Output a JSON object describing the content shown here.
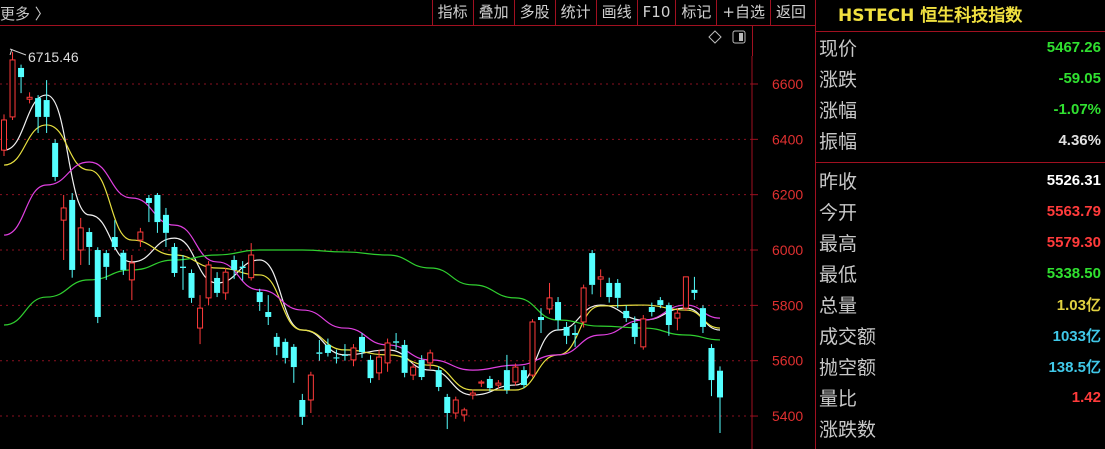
{
  "toolbar": {
    "more": "更多 〉",
    "buttons": [
      "指标",
      "叠加",
      "多股",
      "统计",
      "画线",
      "F10",
      "标记",
      "+自选",
      "返回"
    ]
  },
  "chart_icons": [
    "diamond-icon",
    "panel-toggle-icon"
  ],
  "quote": {
    "title": "HSTECH 恒生科技指数",
    "group1": [
      {
        "label": "现价",
        "value": "5467.26",
        "color": "#30e030"
      },
      {
        "label": "涨跌",
        "value": "-59.05",
        "color": "#30e030"
      },
      {
        "label": "涨幅",
        "value": "-1.07%",
        "color": "#30e030"
      },
      {
        "label": "振幅",
        "value": "4.36%",
        "color": "#e0e0e0"
      }
    ],
    "group2": [
      {
        "label": "昨收",
        "value": "5526.31",
        "color": "#ffffff"
      },
      {
        "label": "今开",
        "value": "5563.79",
        "color": "#ff3b3b"
      },
      {
        "label": "最高",
        "value": "5579.30",
        "color": "#ff3b3b"
      },
      {
        "label": "最低",
        "value": "5338.50",
        "color": "#30e030"
      },
      {
        "label": "总量",
        "value": "1.03亿",
        "color": "#e0d040"
      },
      {
        "label": "成交额",
        "value": "1033亿",
        "color": "#40c8e8"
      },
      {
        "label": "抛空额",
        "value": "138.5亿",
        "color": "#40c8e8"
      },
      {
        "label": "量比",
        "value": "1.42",
        "color": "#ff3b3b"
      },
      {
        "label": "涨跌数",
        "value": "",
        "color": "#ccc"
      }
    ]
  },
  "chart_data": {
    "type": "candlestick",
    "ylim": [
      5280,
      6830
    ],
    "yticks": [
      "6600",
      "6400",
      "6200",
      "6000",
      "5800",
      "5600",
      "5400"
    ],
    "high_marker": "6715.46",
    "up_color": "#ff3b3b",
    "down_color": "#54ffff",
    "candles": [
      [
        6361,
        6490,
        6340,
        6470
      ],
      [
        6481,
        6716,
        6470,
        6687
      ],
      [
        6658,
        6670,
        6567,
        6625
      ],
      [
        6545,
        6570,
        6530,
        6552
      ],
      [
        6549,
        6560,
        6423,
        6481
      ],
      [
        6542,
        6614,
        6423,
        6481
      ],
      [
        6387,
        6400,
        6249,
        6264
      ],
      [
        6108,
        6199,
        5964,
        6152
      ],
      [
        6181,
        6206,
        5900,
        5928
      ],
      [
        6000,
        6116,
        5946,
        6080
      ],
      [
        6065,
        6080,
        5946,
        6011
      ],
      [
        6000,
        6010,
        5736,
        5758
      ],
      [
        5989,
        6000,
        5892,
        5939
      ],
      [
        6047,
        6108,
        6000,
        6011
      ],
      [
        5990,
        6000,
        5910,
        5928
      ],
      [
        5892,
        5982,
        5819,
        5953
      ],
      [
        6036,
        6080,
        6011,
        6065
      ],
      [
        6188,
        6199,
        6101,
        6170
      ],
      [
        6199,
        6206,
        6062,
        6101
      ],
      [
        6127,
        6152,
        6011,
        6062
      ],
      [
        6011,
        6025,
        5903,
        5917
      ],
      [
        5940,
        5982,
        5856,
        5935
      ],
      [
        5917,
        5930,
        5809,
        5827
      ],
      [
        5718,
        5837,
        5660,
        5790
      ],
      [
        5827,
        5960,
        5800,
        5946
      ],
      [
        5899,
        5920,
        5830,
        5845
      ],
      [
        5845,
        5935,
        5820,
        5920
      ],
      [
        5964,
        5980,
        5895,
        5928
      ],
      [
        5940,
        5960,
        5890,
        5935
      ],
      [
        5900,
        6025,
        5890,
        5982
      ],
      [
        5848,
        5860,
        5780,
        5812
      ],
      [
        5776,
        5837,
        5729,
        5758
      ],
      [
        5686,
        5700,
        5620,
        5650
      ],
      [
        5668,
        5680,
        5590,
        5610
      ],
      [
        5650,
        5660,
        5520,
        5577
      ],
      [
        5458,
        5480,
        5368,
        5397
      ],
      [
        5458,
        5560,
        5411,
        5548
      ],
      [
        5630,
        5675,
        5600,
        5625
      ],
      [
        5657,
        5680,
        5615,
        5628
      ],
      [
        5612,
        5640,
        5590,
        5608
      ],
      [
        5621,
        5660,
        5600,
        5618
      ],
      [
        5603,
        5660,
        5580,
        5646
      ],
      [
        5686,
        5700,
        5610,
        5631
      ],
      [
        5603,
        5620,
        5520,
        5537
      ],
      [
        5556,
        5640,
        5530,
        5613
      ],
      [
        5592,
        5680,
        5560,
        5664
      ],
      [
        5670,
        5700,
        5640,
        5665
      ],
      [
        5657,
        5675,
        5540,
        5556
      ],
      [
        5548,
        5590,
        5530,
        5577
      ],
      [
        5603,
        5620,
        5530,
        5541
      ],
      [
        5592,
        5640,
        5570,
        5628
      ],
      [
        5566,
        5580,
        5490,
        5505
      ],
      [
        5469,
        5480,
        5353,
        5411
      ],
      [
        5411,
        5470,
        5390,
        5458
      ],
      [
        5404,
        5430,
        5380,
        5422
      ],
      [
        5476,
        5495,
        5460,
        5483
      ],
      [
        5519,
        5530,
        5505,
        5523
      ],
      [
        5534,
        5545,
        5490,
        5501
      ],
      [
        5512,
        5530,
        5500,
        5519
      ],
      [
        5566,
        5621,
        5480,
        5494
      ],
      [
        5523,
        5590,
        5510,
        5577
      ],
      [
        5566,
        5580,
        5500,
        5512
      ],
      [
        5548,
        5750,
        5540,
        5740
      ],
      [
        5758,
        5790,
        5700,
        5747
      ],
      [
        5787,
        5881,
        5770,
        5827
      ],
      [
        5812,
        5830,
        5710,
        5747
      ],
      [
        5722,
        5740,
        5660,
        5690
      ],
      [
        5700,
        5730,
        5650,
        5693
      ],
      [
        5740,
        5875,
        5720,
        5863
      ],
      [
        5989,
        6000,
        5840,
        5874
      ],
      [
        5895,
        5930,
        5830,
        5903
      ],
      [
        5881,
        5900,
        5810,
        5830
      ],
      [
        5881,
        5895,
        5790,
        5827
      ],
      [
        5780,
        5800,
        5740,
        5754
      ],
      [
        5736,
        5760,
        5660,
        5686
      ],
      [
        5650,
        5765,
        5640,
        5751
      ],
      [
        5794,
        5810,
        5760,
        5776
      ],
      [
        5819,
        5830,
        5790,
        5801
      ],
      [
        5801,
        5810,
        5690,
        5729
      ],
      [
        5754,
        5790,
        5710,
        5772
      ],
      [
        5790,
        5903,
        5780,
        5903
      ],
      [
        5856,
        5903,
        5820,
        5845
      ],
      [
        5790,
        5800,
        5700,
        5722
      ],
      [
        5646,
        5660,
        5472,
        5530
      ],
      [
        5563.79,
        5579.3,
        5338.5,
        5467.26
      ]
    ],
    "ma_sample_every": 5,
    "ma": [
      {
        "name": "MA5",
        "color": "#f0f0f0",
        "values": [
          6361,
          6560,
          6127,
          5957,
          6043,
          5881,
          5964,
          5711,
          5621,
          5639,
          5566,
          5476,
          5512,
          5711,
          5801,
          5747,
          5790,
          5711
        ]
      },
      {
        "name": "MA10",
        "color": "#e8e040",
        "values": [
          6307,
          6452,
          6289,
          6036,
          5982,
          5935,
          5910,
          5711,
          5639,
          5621,
          5584,
          5494,
          5494,
          5621,
          5798,
          5801,
          5783,
          5718
        ]
      },
      {
        "name": "MA20",
        "color": "#e040e0",
        "values": [
          6054,
          6235,
          6318,
          6188,
          6090,
          5957,
          5856,
          5783,
          5718,
          5657,
          5603,
          5566,
          5584,
          5621,
          5693,
          5747,
          5801,
          5754
        ]
      },
      {
        "name": "MA60",
        "color": "#30d030",
        "values": [
          5729,
          5830,
          5892,
          5928,
          5964,
          5982,
          6000,
          6000,
          5993,
          5982,
          5935,
          5874,
          5827,
          5747,
          5725,
          5718,
          5693,
          5675
        ]
      }
    ]
  }
}
